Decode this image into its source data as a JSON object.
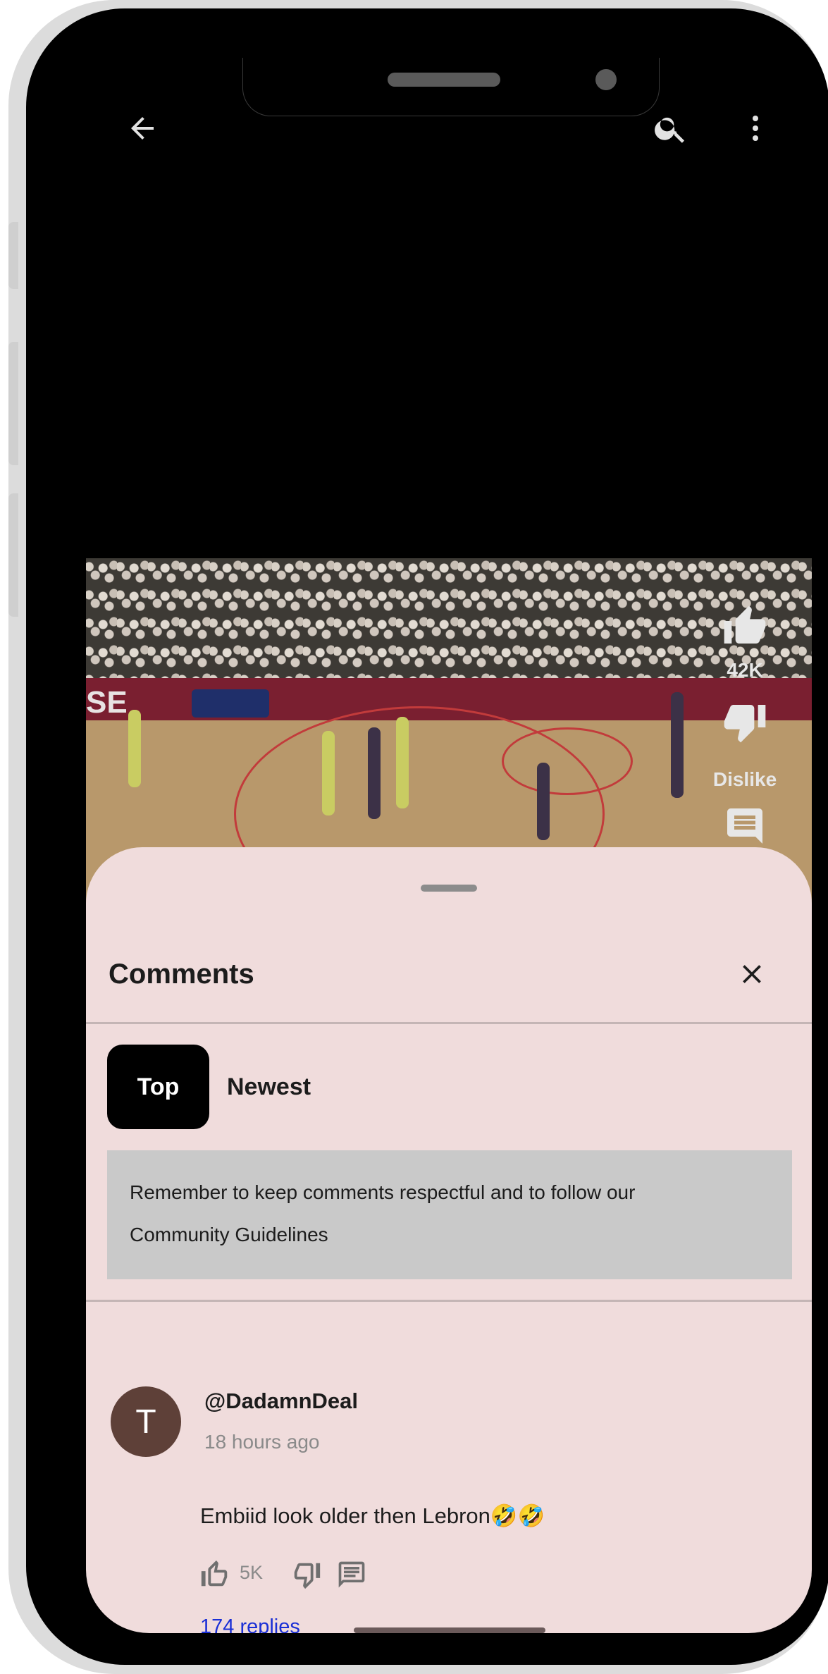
{
  "topbar": {
    "back_icon": "arrow-left-icon",
    "search_icon": "search-icon",
    "more_icon": "more-vertical-icon"
  },
  "video_actions": {
    "like_icon": "thumbs-up-icon",
    "like_count": "42K",
    "dislike_icon": "thumbs-down-icon",
    "dislike_label": "Dislike",
    "comments_icon": "comment-icon"
  },
  "comments_sheet": {
    "title": "Comments",
    "close_icon": "close-icon",
    "sort_tabs": [
      {
        "label": "Top",
        "selected": true
      },
      {
        "label": "Newest",
        "selected": false
      }
    ],
    "notice_line1": "Remember to keep comments respectful and to follow our",
    "notice_line2": "Community Guidelines",
    "comments": [
      {
        "avatar_letter": "T",
        "author": "@DadamnDeal",
        "time": "18 hours ago",
        "text": "Embiid look older then Lebron🤣🤣",
        "like_count": "5K",
        "replies": "174 replies"
      }
    ]
  },
  "colors": {
    "sheet_background": "#f0dcdc",
    "notice_background": "#c9c9c9",
    "selected_chip": "#000000",
    "replies_link": "#1a2fd6",
    "avatar": "#5e4038"
  }
}
